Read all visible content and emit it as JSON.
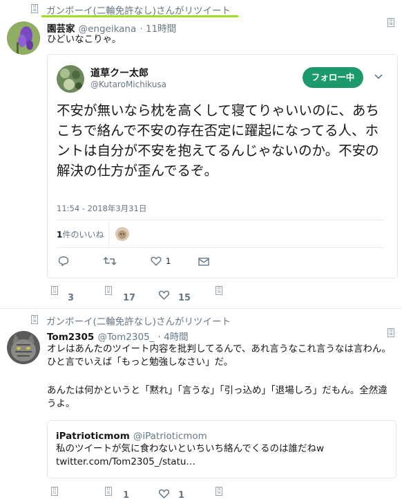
{
  "retweet_banner": "ガンボーイ(二輪免許なし)さんがリツイート",
  "tweet1": {
    "author": "園芸家",
    "handle": "@engeikana",
    "time": "· 11時間",
    "text": "ひどいなこりゃ。",
    "embed": {
      "author": "道草クー太郎",
      "handle": "@KutaroMichikusa",
      "follow_label": "フォロー中",
      "text": "不安が無いなら枕を高くして寝てりゃいいのに、あちこちで絡んで不安の存在否定に躍起になってる人、ホントは自分が不安を抱えてるんじゃないのか。不安の解決の仕方が歪んでるぞ。",
      "timestamp": "11:54 - 2018年3月31日",
      "likes_count": "1",
      "likes_label": "件のいいね",
      "like_action_count": "1"
    },
    "stats": {
      "replies": "3",
      "retweets": "17",
      "likes": "15"
    }
  },
  "tweet2": {
    "retweet_banner": "ガンボーイ(二輪免許なし)さんがリツイート",
    "author": "Tom2305",
    "handle": "@Tom2305_",
    "time": "· 4時間",
    "text1": "オレはあんたのツイート内容を批判してるんで、あれ言うなこれ言うなは言わん。ひと言でいえば「もっと勉強しなさい」だ。",
    "text2": "あんたは何かというと「黙れ」「言うな」「引っ込め」「退場しろ」だもん。全然違うよ。",
    "quote": {
      "author": "iPatrioticmom",
      "handle": "@iPatrioticmom",
      "text": "私のツイートが気に食わないといちいち絡んでくるのは誰だねw",
      "link": "twitter.com/Tom2305_/statu…"
    },
    "stats": {
      "retweets": "1",
      "likes": "1"
    }
  },
  "missing_glyph": "F0 0B",
  "missing_glyph_b": "F1 51",
  "missing_glyph_c": "F1 5E",
  "missing_glyph_d": "F0 59",
  "colors": {
    "accent_green": "#1d9a6c",
    "underline": "#9cdf24",
    "gray": "#657786"
  }
}
